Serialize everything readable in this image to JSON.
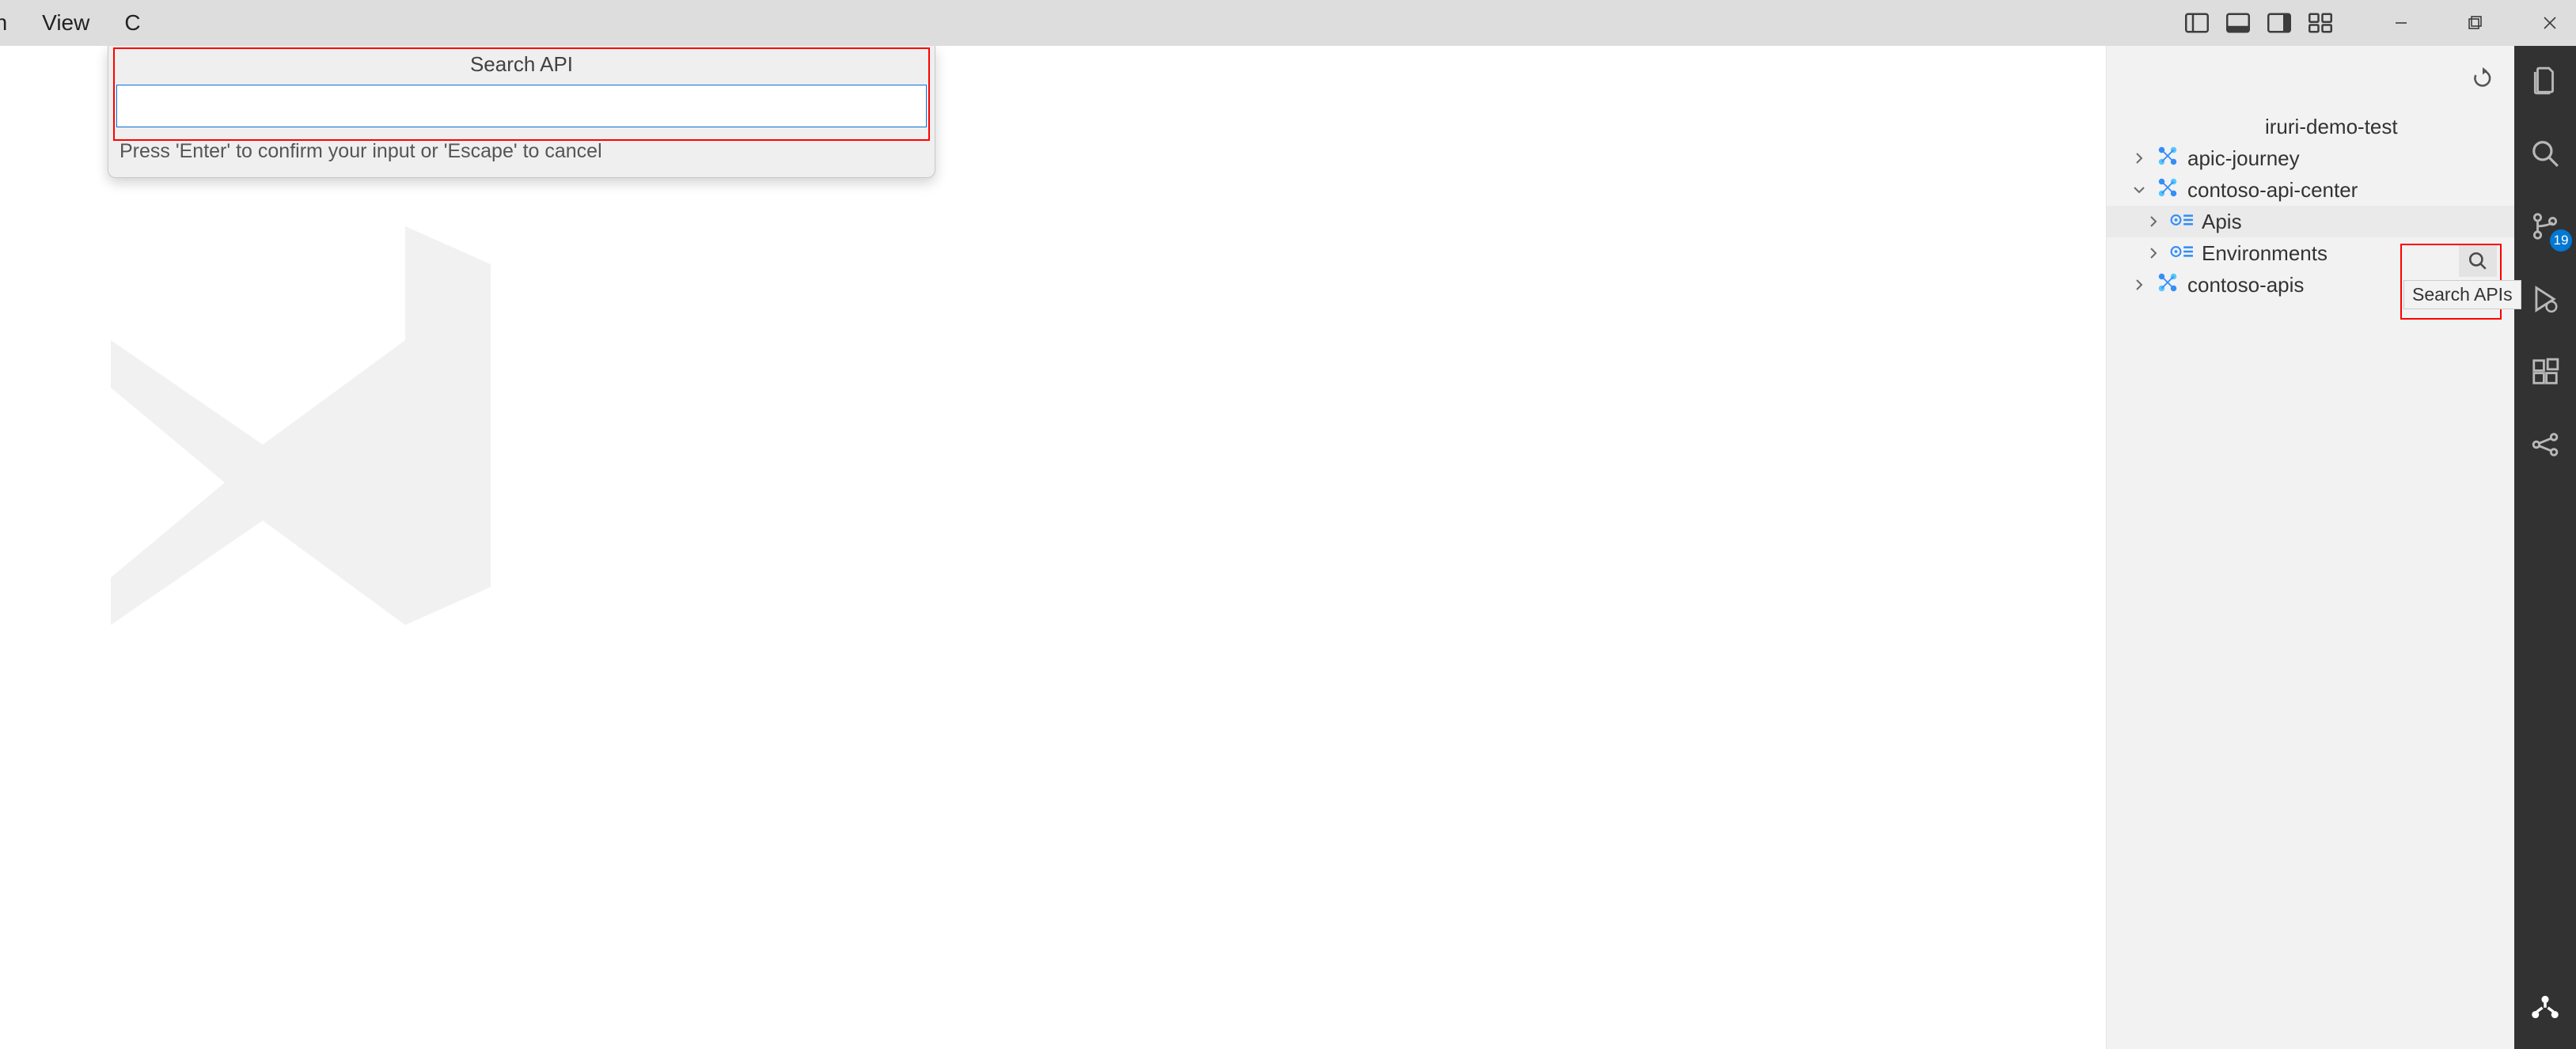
{
  "menubar": {
    "item0_partial": "on",
    "item1": "View",
    "item2_partial": "C"
  },
  "window_controls": {
    "layout_buttons": [
      "panel-left",
      "panel-bottom",
      "panel-right",
      "customize-layout"
    ],
    "controls": [
      "minimize",
      "restore",
      "close"
    ]
  },
  "quick_input": {
    "title": "Search API",
    "value": "",
    "hint": "Press 'Enter' to confirm your input or 'Escape' to cancel"
  },
  "sidebar": {
    "refresh_title": "Refresh",
    "partial_top_label": "iruri-demo-test",
    "nodes": [
      {
        "label": "apic-journey",
        "expanded": false,
        "level": 1,
        "icon": "apic"
      },
      {
        "label": "contoso-api-center",
        "expanded": true,
        "level": 1,
        "icon": "apic"
      },
      {
        "label": "Apis",
        "expanded": false,
        "level": 2,
        "icon": "gearlist",
        "selected": true
      },
      {
        "label": "Environments",
        "expanded": false,
        "level": 2,
        "icon": "gearlist"
      },
      {
        "label": "contoso-apis",
        "expanded": false,
        "level": 1,
        "icon": "apic"
      }
    ],
    "row_action": {
      "tooltip": "Search APIs"
    }
  },
  "activitybar": {
    "items": [
      {
        "name": "explorer",
        "badge": null
      },
      {
        "name": "search",
        "badge": null
      },
      {
        "name": "source-control",
        "badge": "19"
      },
      {
        "name": "run-debug",
        "badge": null
      },
      {
        "name": "extensions",
        "badge": null
      },
      {
        "name": "api-center",
        "badge": null
      }
    ],
    "bottom": {
      "name": "api-center-active"
    }
  }
}
